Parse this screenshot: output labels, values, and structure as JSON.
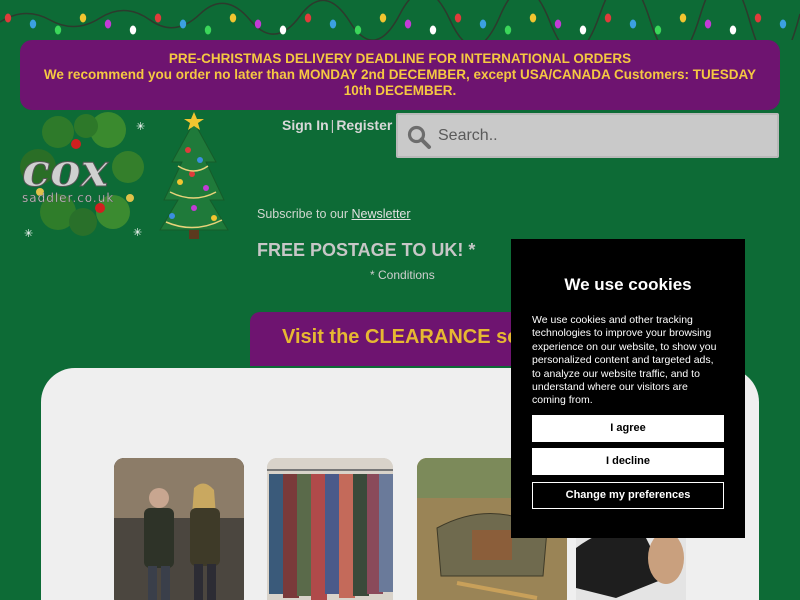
{
  "banner": {
    "line1": "PRE-CHRISTMAS DELIVERY DEADLINE FOR INTERNATIONAL ORDERS",
    "line2": "We recommend you order no later than MONDAY 2nd DECEMBER, except USA/CANADA Customers: TUESDAY 10th DECEMBER."
  },
  "logo": {
    "text": "cox",
    "subtext": "saddler.co.uk"
  },
  "header": {
    "sign_in": "Sign In",
    "separator": "|",
    "register": "Register",
    "search_placeholder": "Search.."
  },
  "promo": {
    "subscribe_prefix": "Subscribe to our ",
    "newsletter_link": "Newsletter",
    "free_postage": "FREE POSTAGE TO UK! *",
    "conditions": "* Conditions",
    "clearance": "Visit the CLEARANCE section"
  },
  "cookie": {
    "title": "We use cookies",
    "body": "We use cookies and other tracking technologies to improve your browsing experience on our website, to show you personalized content and targeted ads, to analyze our website traffic, and to understand where our visitors are coming from.",
    "agree": "I agree",
    "decline": "I decline",
    "preferences": "Change my preferences"
  },
  "colors": {
    "page_bg": "#0d6b36",
    "banner_bg": "#6e1470",
    "banner_text": "#f5c842",
    "cookie_bg": "#000000"
  },
  "icons": [
    "search-icon",
    "christmas-tree-icon",
    "holly-wreath-icon",
    "christmas-lights-icon"
  ]
}
